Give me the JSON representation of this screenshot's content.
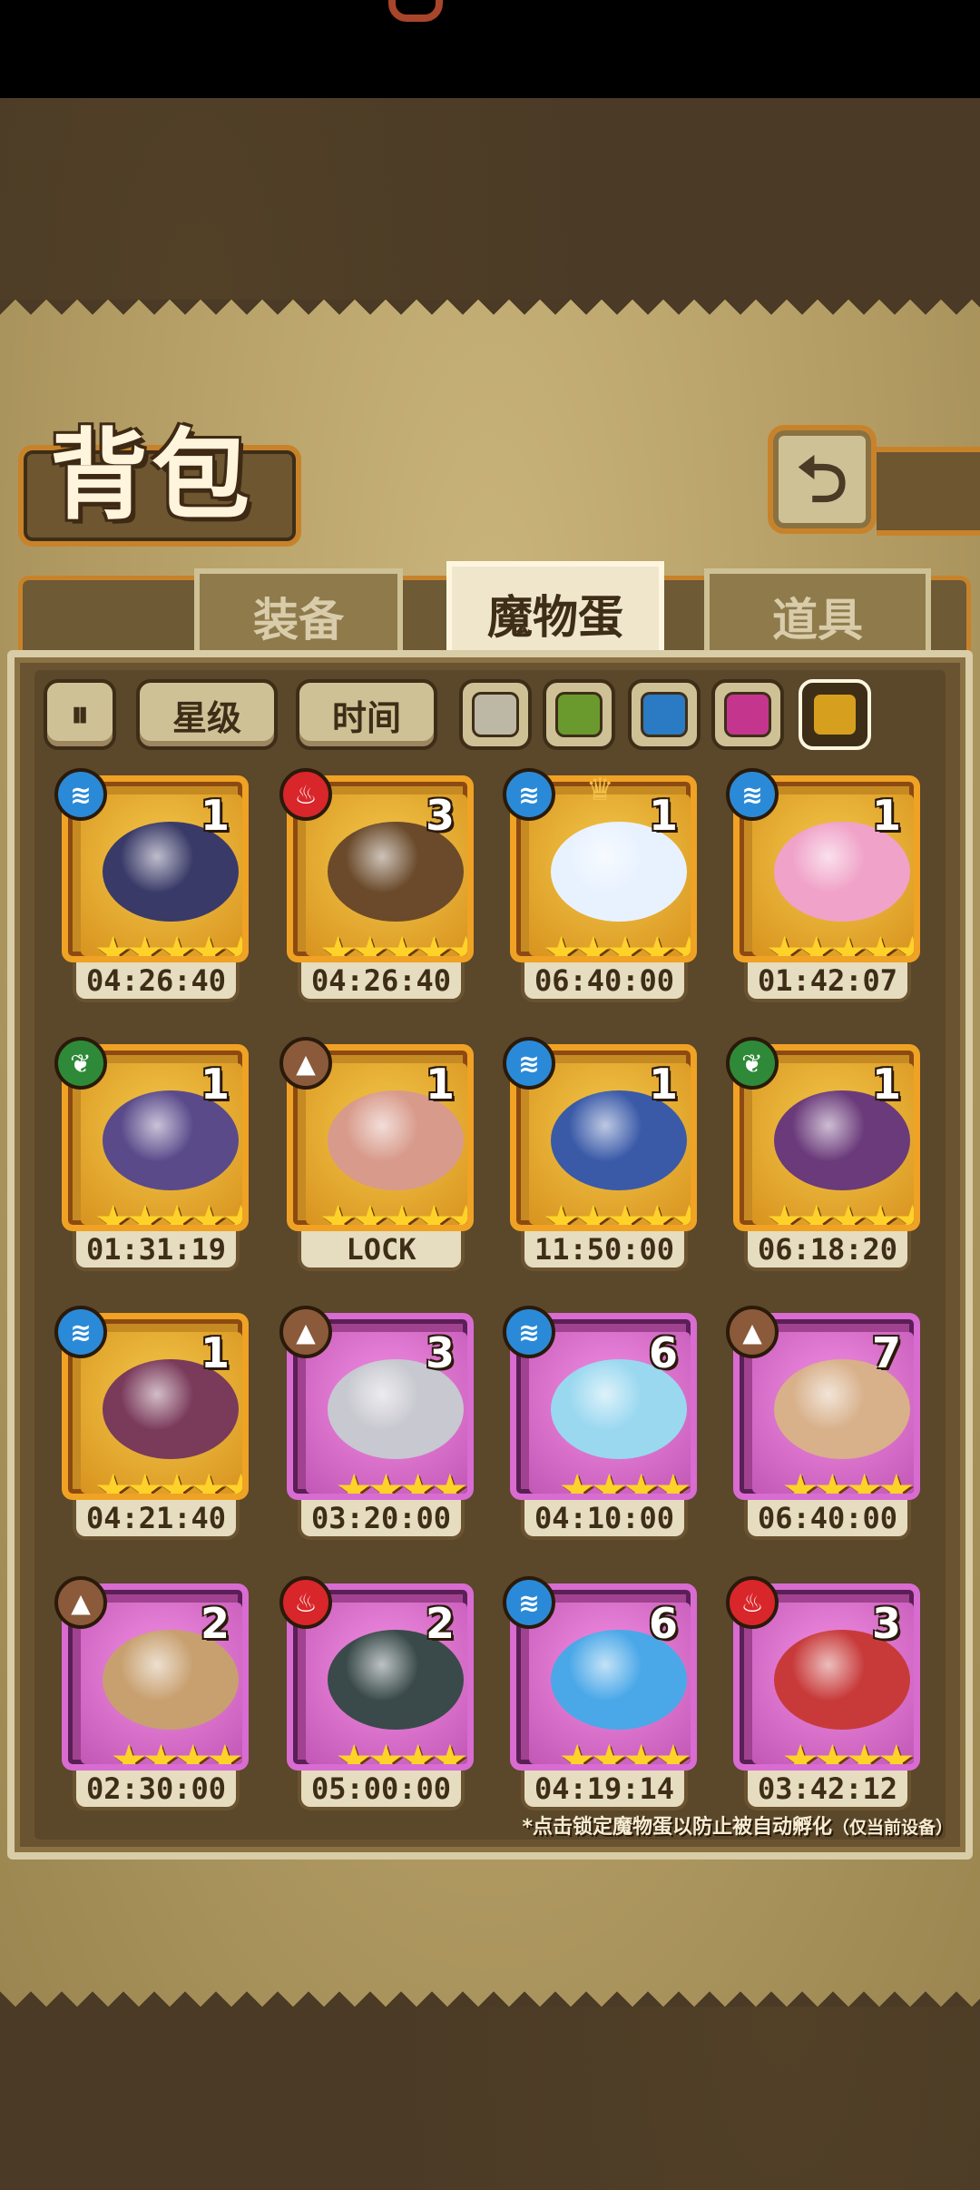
{
  "title": "背包",
  "back_icon": "back-arrow-icon",
  "tabs": [
    {
      "label": "装备",
      "active": false
    },
    {
      "label": "魔物蛋",
      "active": true
    },
    {
      "label": "道具",
      "active": false
    }
  ],
  "filters": {
    "sort_icon": "sort-toggle-icon",
    "star_label": "星级",
    "time_label": "时间",
    "swatches": [
      "#bdb8a6",
      "#6a9a2e",
      "#2a7ac4",
      "#c4368e",
      "#d6a01e"
    ],
    "selected_swatch": 4
  },
  "eggs": [
    {
      "element": "water",
      "count": "1",
      "stars": 5,
      "rarity": "gold",
      "timer": "04:26:40",
      "color": "#3a3a68"
    },
    {
      "element": "fire",
      "count": "3",
      "stars": 5,
      "rarity": "gold",
      "timer": "04:26:40",
      "color": "#6a4a2a"
    },
    {
      "element": "water",
      "count": "1",
      "stars": 5,
      "rarity": "gold",
      "timer": "06:40:00",
      "color": "#e8f2ff",
      "crown": true
    },
    {
      "element": "water",
      "count": "1",
      "stars": 5,
      "rarity": "gold",
      "timer": "01:42:07",
      "color": "#f0a2c8"
    },
    {
      "element": "grass",
      "count": "1",
      "stars": 5,
      "rarity": "gold",
      "timer": "01:31:19",
      "color": "#5a4a8a"
    },
    {
      "element": "earth",
      "count": "1",
      "stars": 5,
      "rarity": "gold",
      "timer": "LOCK",
      "color": "#d89a8a"
    },
    {
      "element": "water",
      "count": "1",
      "stars": 5,
      "rarity": "gold",
      "timer": "11:50:00",
      "color": "#3a5aa8"
    },
    {
      "element": "grass",
      "count": "1",
      "stars": 5,
      "rarity": "gold",
      "timer": "06:18:20",
      "color": "#6a3a7a"
    },
    {
      "element": "water",
      "count": "1",
      "stars": 5,
      "rarity": "gold",
      "timer": "04:21:40",
      "color": "#7a3a5a"
    },
    {
      "element": "earth",
      "count": "3",
      "stars": 4,
      "rarity": "purple",
      "timer": "03:20:00",
      "color": "#c8c8d0"
    },
    {
      "element": "water",
      "count": "6",
      "stars": 4,
      "rarity": "purple",
      "timer": "04:10:00",
      "color": "#9ad8f0"
    },
    {
      "element": "earth",
      "count": "7",
      "stars": 4,
      "rarity": "purple",
      "timer": "06:40:00",
      "color": "#d8b08a"
    },
    {
      "element": "earth",
      "count": "2",
      "stars": 4,
      "rarity": "purple",
      "timer": "02:30:00",
      "color": "#c8a070"
    },
    {
      "element": "fire",
      "count": "2",
      "stars": 4,
      "rarity": "purple",
      "timer": "05:00:00",
      "color": "#3a4a4a"
    },
    {
      "element": "water",
      "count": "6",
      "stars": 4,
      "rarity": "purple",
      "timer": "04:19:14",
      "color": "#4aa8e8"
    },
    {
      "element": "fire",
      "count": "3",
      "stars": 4,
      "rarity": "purple",
      "timer": "03:42:12",
      "color": "#c83a3a"
    }
  ],
  "note": "*点击锁定魔物蛋以防止被自动孵化",
  "note_suffix": "（仅当前设备）"
}
